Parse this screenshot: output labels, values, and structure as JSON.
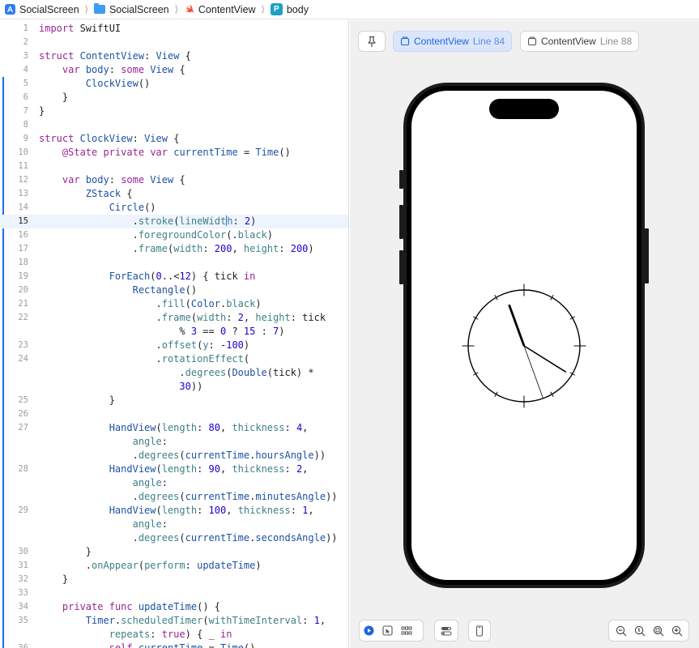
{
  "breadcrumb": {
    "items": [
      "SocialScreen",
      "SocialScreen",
      "ContentView",
      "body"
    ]
  },
  "editor": {
    "current_line": 15,
    "lines": [
      {
        "n": "1",
        "html": "<span class='k'>import</span> SwiftUI"
      },
      {
        "n": "2",
        "html": ""
      },
      {
        "n": "3",
        "html": "<span class='k'>struct</span> <span class='t'>ContentView</span>: <span class='t'>View</span> {"
      },
      {
        "n": "4",
        "html": "    <span class='k'>var</span> <span class='t'>body</span>: <span class='k'>some</span> <span class='t'>View</span> {"
      },
      {
        "n": "5",
        "html": "        <span class='t'>ClockView</span>()"
      },
      {
        "n": "6",
        "html": "    }"
      },
      {
        "n": "7",
        "html": "}"
      },
      {
        "n": "8",
        "html": ""
      },
      {
        "n": "9",
        "html": "<span class='k'>struct</span> <span class='t'>ClockView</span>: <span class='t'>View</span> {"
      },
      {
        "n": "10",
        "html": "    <span class='k'>@State</span> <span class='k'>private</span> <span class='k'>var</span> <span class='t'>currentTime</span> = <span class='t'>Time</span>()"
      },
      {
        "n": "11",
        "html": ""
      },
      {
        "n": "12",
        "html": "    <span class='k'>var</span> <span class='t'>body</span>: <span class='k'>some</span> <span class='t'>View</span> {"
      },
      {
        "n": "13",
        "html": "        <span class='t'>ZStack</span> {"
      },
      {
        "n": "14",
        "html": "            <span class='t'>Circle</span>()"
      },
      {
        "n": "15",
        "html": "                .<span class='m'>stroke</span>(<span class='m'>lineWidt</span><span class='caret'></span><span class='m'>h</span>: <span class='n'>2</span>)"
      },
      {
        "n": "16",
        "html": "                .<span class='m'>foregroundColor</span>(.<span class='m'>black</span>)"
      },
      {
        "n": "17",
        "html": "                .<span class='m'>frame</span>(<span class='m'>width</span>: <span class='n'>200</span>, <span class='m'>height</span>: <span class='n'>200</span>)"
      },
      {
        "n": "18",
        "html": ""
      },
      {
        "n": "19",
        "html": "            <span class='t'>ForEach</span>(<span class='n'>0</span>..&lt;<span class='n'>12</span>) { tick <span class='k'>in</span>"
      },
      {
        "n": "20",
        "html": "                <span class='t'>Rectangle</span>()"
      },
      {
        "n": "21",
        "html": "                    .<span class='m'>fill</span>(<span class='t'>Color</span>.<span class='m'>black</span>)"
      },
      {
        "n": "22",
        "html": "                    .<span class='m'>frame</span>(<span class='m'>width</span>: <span class='n'>2</span>, <span class='m'>height</span>: tick"
      },
      {
        "n": "",
        "html": "                        % <span class='n'>3</span> == <span class='n'>0</span> ? <span class='n'>15</span> : <span class='n'>7</span>)"
      },
      {
        "n": "23",
        "html": "                    .<span class='m'>offset</span>(<span class='m'>y</span>: -<span class='n'>100</span>)"
      },
      {
        "n": "24",
        "html": "                    .<span class='m'>rotationEffect</span>("
      },
      {
        "n": "",
        "html": "                        .<span class='m'>degrees</span>(<span class='t'>Double</span>(tick) *"
      },
      {
        "n": "",
        "html": "                        <span class='n'>30</span>))"
      },
      {
        "n": "25",
        "html": "            }"
      },
      {
        "n": "26",
        "html": ""
      },
      {
        "n": "27",
        "html": "            <span class='t'>HandView</span>(<span class='m'>length</span>: <span class='n'>80</span>, <span class='m'>thickness</span>: <span class='n'>4</span>,"
      },
      {
        "n": "",
        "html": "                <span class='m'>angle</span>:"
      },
      {
        "n": "",
        "html": "                .<span class='m'>degrees</span>(<span class='t'>currentTime</span>.<span class='t'>hoursAngle</span>))"
      },
      {
        "n": "28",
        "html": "            <span class='t'>HandView</span>(<span class='m'>length</span>: <span class='n'>90</span>, <span class='m'>thickness</span>: <span class='n'>2</span>,"
      },
      {
        "n": "",
        "html": "                <span class='m'>angle</span>:"
      },
      {
        "n": "",
        "html": "                .<span class='m'>degrees</span>(<span class='t'>currentTime</span>.<span class='t'>minutesAngle</span>))"
      },
      {
        "n": "29",
        "html": "            <span class='t'>HandView</span>(<span class='m'>length</span>: <span class='n'>100</span>, <span class='m'>thickness</span>: <span class='n'>1</span>,"
      },
      {
        "n": "",
        "html": "                <span class='m'>angle</span>:"
      },
      {
        "n": "",
        "html": "                .<span class='m'>degrees</span>(<span class='t'>currentTime</span>.<span class='t'>secondsAngle</span>))"
      },
      {
        "n": "30",
        "html": "        }"
      },
      {
        "n": "31",
        "html": "        .<span class='m'>onAppear</span>(<span class='m'>perform</span>: <span class='t'>updateTime</span>)"
      },
      {
        "n": "32",
        "html": "    }"
      },
      {
        "n": "33",
        "html": ""
      },
      {
        "n": "34",
        "html": "    <span class='k'>private</span> <span class='k'>func</span> <span class='t'>updateTime</span>() {"
      },
      {
        "n": "35",
        "html": "        <span class='t'>Timer</span>.<span class='m'>scheduledTimer</span>(<span class='m'>withTimeInterval</span>: <span class='n'>1</span>,"
      },
      {
        "n": "",
        "html": "            <span class='m'>repeats</span>: <span class='k'>true</span>) { _ <span class='k'>in</span>"
      },
      {
        "n": "36",
        "html": "            <span class='k'>self</span>.<span class='t'>currentTime</span> = <span class='t'>Time</span>()"
      }
    ]
  },
  "canvas": {
    "pin_icon": "pin-icon",
    "tabs": [
      {
        "label": "ContentView",
        "sub": "Line 84",
        "active": true
      },
      {
        "label": "ContentView",
        "sub": "Line 88",
        "active": false
      }
    ],
    "clock": {
      "tick_count": 12,
      "hour_hand_angle_deg": 340,
      "minute_hand_angle_deg": 122,
      "second_hand_angle_deg": 160
    },
    "bottom_left_icons": [
      "live-preview-icon",
      "selectable-icon",
      "variants-icon",
      "device-settings-icon",
      "device-icon"
    ],
    "bottom_right_icons": [
      "zoom-out-icon",
      "zoom-100-icon",
      "zoom-fit-icon",
      "zoom-in-icon"
    ]
  },
  "colors": {
    "accent": "#1f66e0",
    "keyword": "#9b2393",
    "type": "#1c52a3",
    "method": "#3d8088",
    "number": "#1c00cf"
  }
}
